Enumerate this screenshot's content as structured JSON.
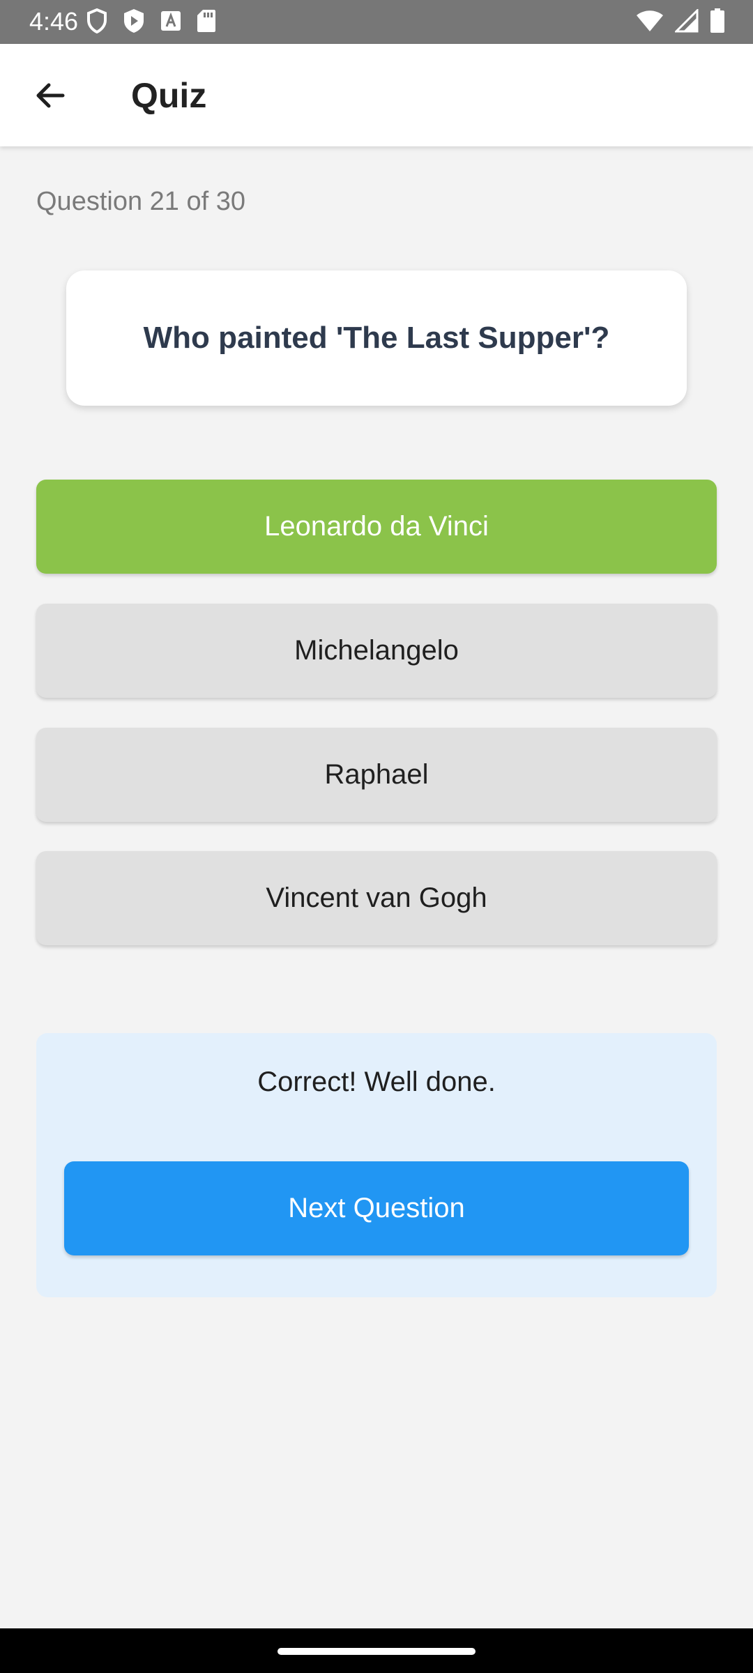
{
  "status_bar": {
    "time": "4:46",
    "left_icons": [
      "shield-icon",
      "play-protect-icon",
      "font-icon",
      "sd-card-icon"
    ],
    "right_icons": [
      "wifi-icon",
      "cell-signal-icon",
      "battery-icon"
    ]
  },
  "app_bar": {
    "back_icon": "arrow-left-icon",
    "title": "Quiz"
  },
  "quiz": {
    "progress": "Question 21 of 30",
    "question": "Who painted 'The Last Supper'?",
    "answers": [
      {
        "label": "Leonardo da Vinci",
        "state": "correct"
      },
      {
        "label": "Michelangelo",
        "state": "neutral"
      },
      {
        "label": "Raphael",
        "state": "neutral"
      },
      {
        "label": "Vincent van Gogh",
        "state": "neutral"
      }
    ]
  },
  "feedback": {
    "message": "Correct! Well done.",
    "next_label": "Next Question"
  },
  "colors": {
    "correct": "#8bc34a",
    "neutral": "#e0e0e0",
    "primary": "#2196f3",
    "feedback_bg": "#e3f0fc",
    "page_bg": "#f3f3f3"
  }
}
